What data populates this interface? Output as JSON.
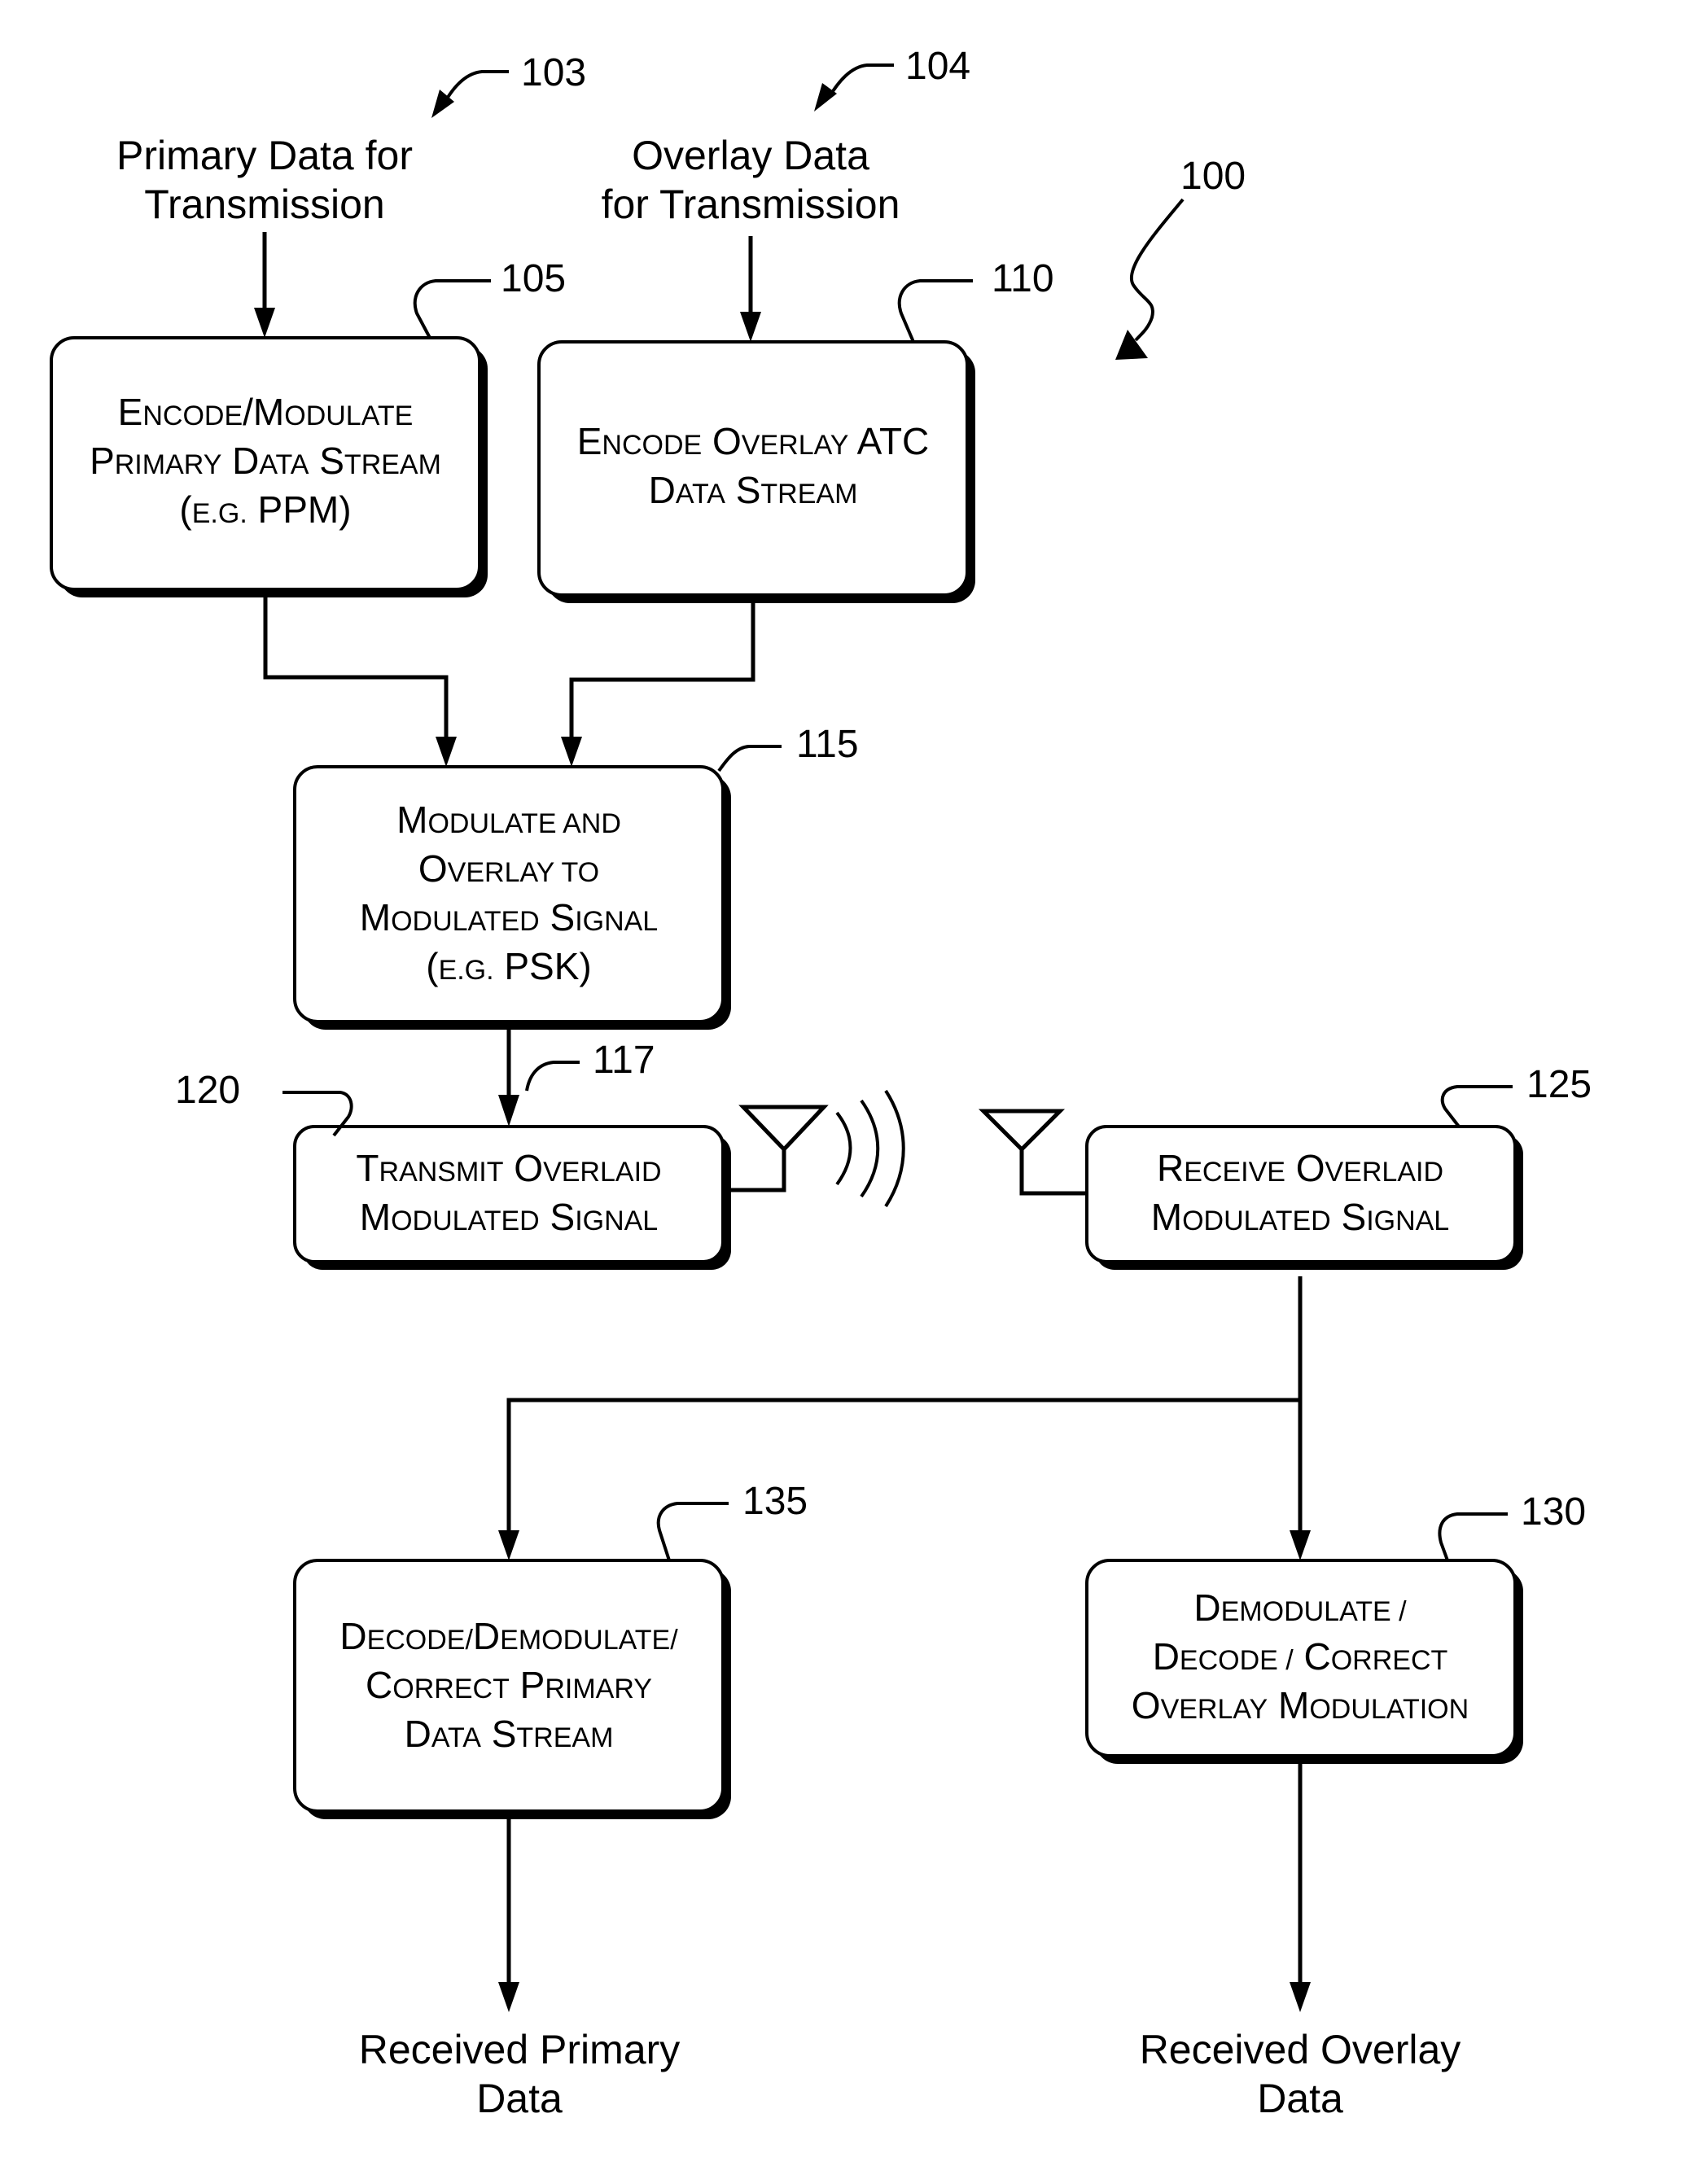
{
  "figure": {
    "ref": "100",
    "inputs": {
      "primary": {
        "ref": "103",
        "lines": [
          "Primary Data for",
          "Transmission"
        ]
      },
      "overlay": {
        "ref": "104",
        "lines": [
          "Overlay Data",
          "for Transmission"
        ]
      }
    },
    "blocks": {
      "encode_primary": {
        "ref": "105",
        "lines": [
          [
            "E",
            "NCODE",
            "/M",
            "ODULATE"
          ],
          [
            "P",
            "RIMARY",
            " D",
            "ATA",
            " S",
            "TREAM"
          ],
          [
            "(",
            "E.G.",
            " PPM)",
            ""
          ]
        ]
      },
      "encode_overlay": {
        "ref": "110",
        "lines": [
          [
            "E",
            "NCODE",
            " O",
            "VERLAY",
            " ATC",
            ""
          ],
          [
            "D",
            "ATA",
            " S",
            "TREAM"
          ]
        ]
      },
      "modulate_overlay": {
        "ref": "115",
        "lines": [
          [
            "M",
            "ODULATE AND"
          ],
          [
            "O",
            "VERLAY TO"
          ],
          [
            "M",
            "ODULATED",
            " S",
            "IGNAL"
          ],
          [
            "(",
            "E.G.",
            " PSK)",
            ""
          ]
        ]
      },
      "transmit": {
        "ref": "120",
        "signal_ref": "117",
        "lines": [
          [
            "T",
            "RANSMIT",
            " O",
            "VERLAID"
          ],
          [
            "M",
            "ODULATED",
            " S",
            "IGNAL"
          ]
        ]
      },
      "receive": {
        "ref": "125",
        "lines": [
          [
            "R",
            "ECEIVE",
            " O",
            "VERLAID"
          ],
          [
            "M",
            "ODULATED",
            " S",
            "IGNAL"
          ]
        ]
      },
      "demod_overlay": {
        "ref": "130",
        "lines": [
          [
            "D",
            "EMODULATE /"
          ],
          [
            "D",
            "ECODE /",
            " C",
            "ORRECT"
          ],
          [
            "O",
            "VERLAY",
            " M",
            "ODULATION"
          ]
        ]
      },
      "decode_primary": {
        "ref": "135",
        "lines": [
          [
            "D",
            "ECODE/",
            "D",
            "EMODULATE/"
          ],
          [
            "C",
            "ORRECT",
            " P",
            "RIMARY"
          ],
          [
            "D",
            "ATA",
            " S",
            "TREAM"
          ]
        ]
      }
    },
    "outputs": {
      "primary": {
        "lines": [
          "Received Primary",
          "Data"
        ]
      },
      "overlay": {
        "lines": [
          "Received Overlay",
          "Data"
        ]
      }
    }
  }
}
